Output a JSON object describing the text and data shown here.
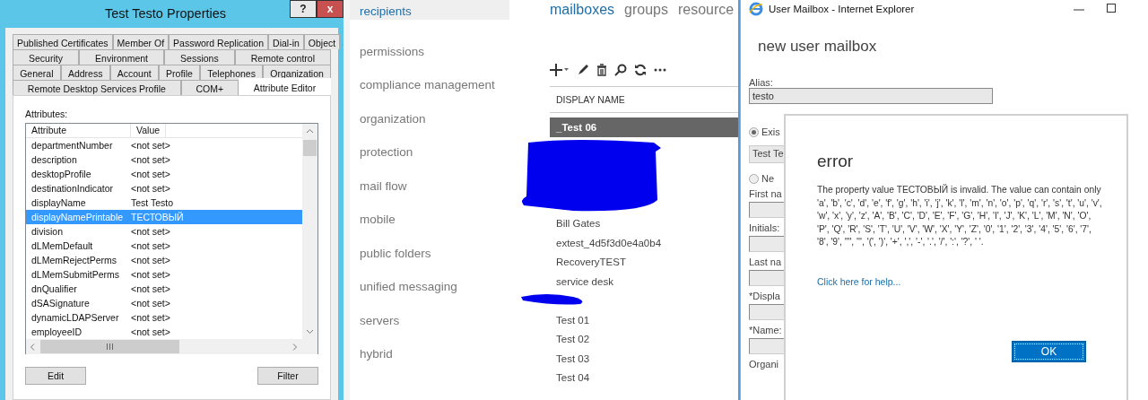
{
  "properties_dialog": {
    "title": "Test Testo Properties",
    "help_button": "?",
    "close_button": "x",
    "tab_rows": [
      [
        {
          "label": "Published Certificates",
          "selected": false
        },
        {
          "label": "Member Of",
          "selected": false
        },
        {
          "label": "Password Replication",
          "selected": false
        },
        {
          "label": "Dial-in",
          "selected": false
        },
        {
          "label": "Object",
          "selected": false
        }
      ],
      [
        {
          "label": "Security",
          "selected": false
        },
        {
          "label": "Environment",
          "selected": false
        },
        {
          "label": "Sessions",
          "selected": false
        },
        {
          "label": "Remote control",
          "selected": false
        }
      ],
      [
        {
          "label": "General",
          "selected": false
        },
        {
          "label": "Address",
          "selected": false
        },
        {
          "label": "Account",
          "selected": false
        },
        {
          "label": "Profile",
          "selected": false
        },
        {
          "label": "Telephones",
          "selected": false
        },
        {
          "label": "Organization",
          "selected": false
        }
      ],
      [
        {
          "label": "Remote Desktop Services Profile",
          "selected": false
        },
        {
          "label": "COM+",
          "selected": false
        },
        {
          "label": "Attribute Editor",
          "selected": true
        }
      ]
    ],
    "attributes_label": "Attributes:",
    "columns": [
      "Attribute",
      "Value"
    ],
    "rows": [
      {
        "attribute": "departmentNumber",
        "value": "<not set>",
        "selected": false
      },
      {
        "attribute": "description",
        "value": "<not set>",
        "selected": false
      },
      {
        "attribute": "desktopProfile",
        "value": "<not set>",
        "selected": false
      },
      {
        "attribute": "destinationIndicator",
        "value": "<not set>",
        "selected": false
      },
      {
        "attribute": "displayName",
        "value": "Test Testo",
        "selected": false
      },
      {
        "attribute": "displayNamePrintable",
        "value": "ТЕСТОВЫЙ",
        "selected": true
      },
      {
        "attribute": "division",
        "value": "<not set>",
        "selected": false
      },
      {
        "attribute": "dLMemDefault",
        "value": "<not set>",
        "selected": false
      },
      {
        "attribute": "dLMemRejectPerms",
        "value": "<not set>",
        "selected": false
      },
      {
        "attribute": "dLMemSubmitPerms",
        "value": "<not set>",
        "selected": false
      },
      {
        "attribute": "dnQualifier",
        "value": "<not set>",
        "selected": false
      },
      {
        "attribute": "dSASignature",
        "value": "<not set>",
        "selected": false
      },
      {
        "attribute": "dynamicLDAPServer",
        "value": "<not set>",
        "selected": false
      },
      {
        "attribute": "employeeID",
        "value": "<not set>",
        "selected": false
      }
    ],
    "buttons": [
      "Edit",
      "Filter"
    ]
  },
  "admin_center": {
    "nav": [
      {
        "label": "recipients",
        "selected": true
      },
      {
        "label": "permissions",
        "selected": false
      },
      {
        "label": "compliance management",
        "selected": false
      },
      {
        "label": "organization",
        "selected": false
      },
      {
        "label": "protection",
        "selected": false
      },
      {
        "label": "mail flow",
        "selected": false
      },
      {
        "label": "mobile",
        "selected": false
      },
      {
        "label": "public folders",
        "selected": false
      },
      {
        "label": "unified messaging",
        "selected": false
      },
      {
        "label": "servers",
        "selected": false
      },
      {
        "label": "hybrid",
        "selected": false
      }
    ],
    "tabs": [
      {
        "label": "mailboxes",
        "selected": true
      },
      {
        "label": "groups",
        "selected": false
      },
      {
        "label": "resource",
        "selected": false
      }
    ],
    "column": "DISPLAY NAME",
    "mailboxes": [
      {
        "kind": "row",
        "name": "_Test 06",
        "selected": true
      },
      {
        "kind": "redacted_block"
      },
      {
        "kind": "row",
        "name": "Bill Gates",
        "selected": false
      },
      {
        "kind": "row",
        "name": "extest_4d5f3d0e4a0b4",
        "selected": false
      },
      {
        "kind": "row",
        "name": "RecoveryTEST",
        "selected": false
      },
      {
        "kind": "row",
        "name": "service desk",
        "selected": false
      },
      {
        "kind": "redacted_line"
      },
      {
        "kind": "row",
        "name": "Test 01",
        "selected": false
      },
      {
        "kind": "row",
        "name": "Test 02",
        "selected": false
      },
      {
        "kind": "row",
        "name": "Test 03",
        "selected": false
      },
      {
        "kind": "row",
        "name": "Test 04",
        "selected": false
      }
    ]
  },
  "ie_window": {
    "title": "User Mailbox - Internet Explorer",
    "heading": "new user mailbox",
    "alias_label": "Alias:",
    "alias_value": "testo",
    "form": [
      {
        "kind": "radio",
        "label": "Exis",
        "selected": true
      },
      {
        "kind": "value_box",
        "value": "Test Te"
      },
      {
        "kind": "radio",
        "label": "Ne",
        "selected": false
      },
      {
        "kind": "field",
        "label": "First na"
      },
      {
        "kind": "field",
        "label": "Initials:"
      },
      {
        "kind": "field",
        "label": "Last na"
      },
      {
        "kind": "field",
        "label": "*Displa"
      },
      {
        "kind": "field",
        "label": "*Name:"
      },
      {
        "kind": "label",
        "label": "Organi"
      }
    ],
    "error": {
      "title": "error",
      "message": "The property value ТЕСТОВЫЙ is invalid. The value can contain only 'a', 'b', 'c', 'd', 'e', 'f', 'g', 'h', 'i', 'j', 'k', 'l', 'm', 'n', 'o', 'p', 'q', 'r', 's', 't', 'u', 'v', 'w', 'x', 'y', 'z', 'A', 'B', 'C', 'D', 'E', 'F', 'G', 'H', 'I', 'J', 'K', 'L', 'M', 'N', 'O', 'P', 'Q', 'R', 'S', 'T', 'U', 'V', 'W', 'X', 'Y', 'Z', '0', '1', '2', '3', '4', '5', '6', '7', '8', '9', '\"', ''', '(', ')', '+', ',', '-', '.', '/', ':', '?', ' '.",
      "help_link": "Click here for help...",
      "ok_button": "OK"
    }
  }
}
